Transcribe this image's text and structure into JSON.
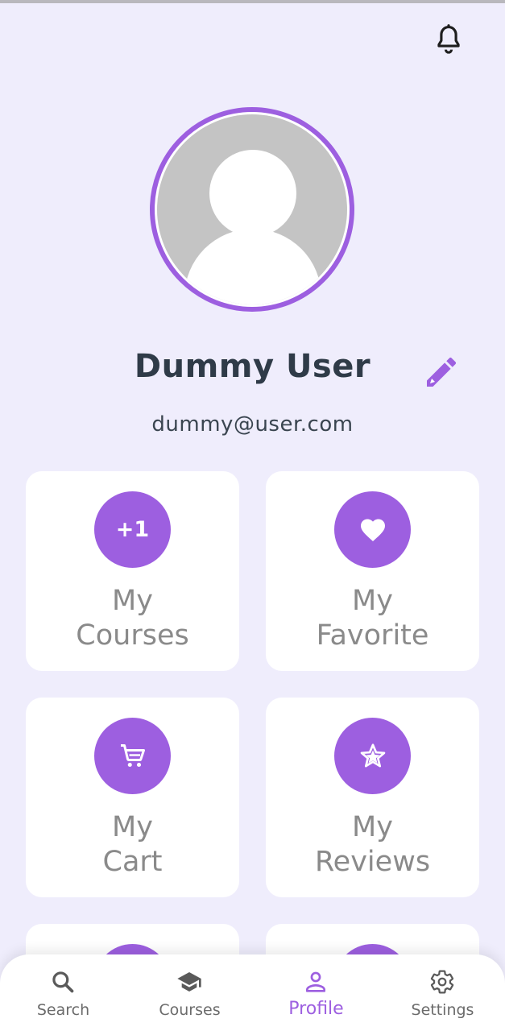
{
  "user": {
    "name": "Dummy User",
    "email": "dummy@user.com"
  },
  "cards": [
    {
      "id": "courses",
      "badge": "+1",
      "line1": "My",
      "line2": "Courses",
      "icon": "plus-one-icon"
    },
    {
      "id": "favorite",
      "badge": "",
      "line1": "My",
      "line2": "Favorite",
      "icon": "heart-icon"
    },
    {
      "id": "cart",
      "badge": "",
      "line1": "My",
      "line2": "Cart",
      "icon": "cart-icon"
    },
    {
      "id": "reviews",
      "badge": "",
      "line1": "My",
      "line2": "Reviews",
      "icon": "star-icon"
    }
  ],
  "nav": {
    "items": [
      {
        "label": "Search",
        "icon": "search-icon"
      },
      {
        "label": "Courses",
        "icon": "graduation-cap-icon"
      },
      {
        "label": "Profile",
        "icon": "person-icon",
        "active": true
      },
      {
        "label": "Settings",
        "icon": "gear-icon"
      }
    ]
  },
  "colors": {
    "accent": "#9d5fe0",
    "background": "#efedfc",
    "card": "#ffffff",
    "name_text": "#2f3b48",
    "card_label": "#8a8a8a"
  }
}
